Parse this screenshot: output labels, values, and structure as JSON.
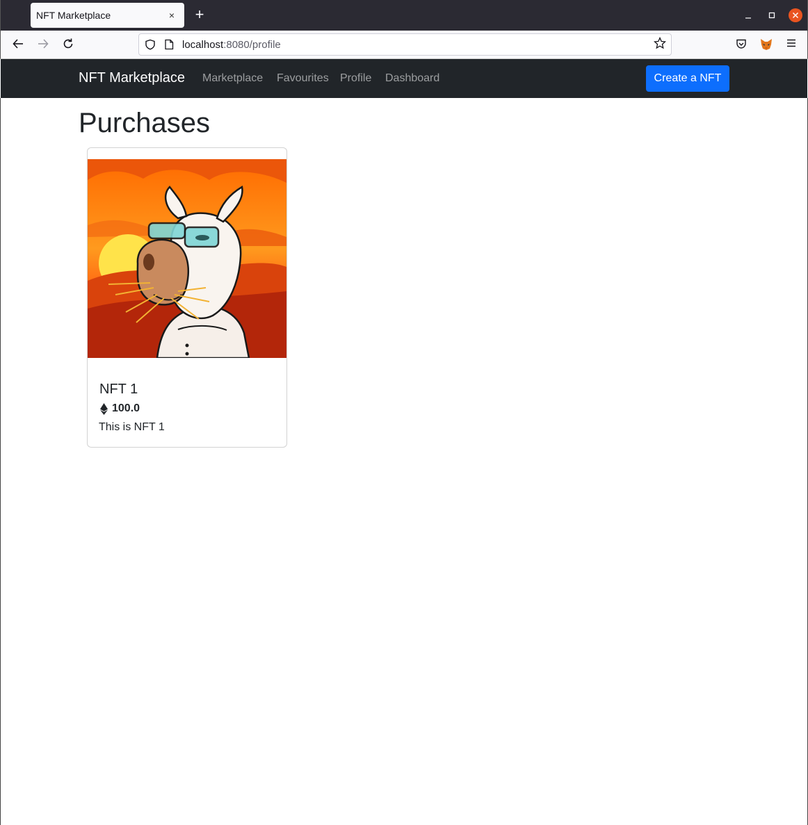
{
  "browser": {
    "tab_title": "NFT Marketplace",
    "tab_close": "×",
    "new_tab": "+",
    "url_host": "localhost",
    "url_rest": ":8080/profile"
  },
  "nav": {
    "brand": "NFT Marketplace",
    "links": [
      "Marketplace",
      "Favourites",
      "Profile",
      "Dashboard"
    ],
    "create_button": "Create a NFT"
  },
  "page": {
    "heading": "Purchases"
  },
  "cards": [
    {
      "title": "NFT 1",
      "price": "100.0",
      "currency_icon": "ethereum-icon",
      "description": "This is NFT 1",
      "image_icon": "llama-nft-artwork"
    }
  ],
  "colors": {
    "navbar_bg": "#212529",
    "primary": "#0d6efd",
    "tab_bar": "#2b2a33",
    "close_button": "#e95420"
  }
}
